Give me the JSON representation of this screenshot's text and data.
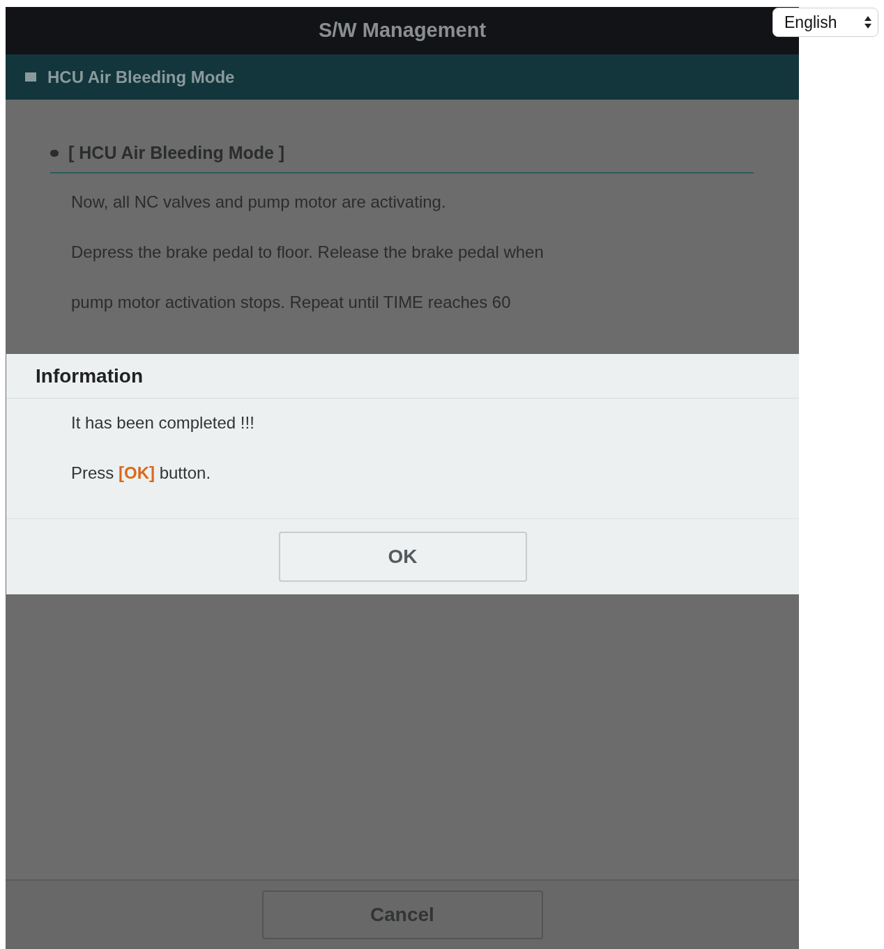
{
  "window": {
    "title": "S/W Management"
  },
  "section": {
    "title": "HCU Air Bleeding Mode"
  },
  "content": {
    "heading": "[ HCU Air Bleeding Mode ]",
    "paragraphs": [
      "Now, all NC valves and pump motor are activating.",
      "Depress the brake pedal to floor. Release the brake pedal when",
      "pump motor activation stops. Repeat until TIME reaches 60"
    ]
  },
  "dialog": {
    "title": "Information",
    "lines": [
      "It has been completed !!!",
      "Press **[OK]** button."
    ],
    "button": "OK"
  },
  "footer": {
    "button": "Cancel"
  },
  "language_select": {
    "value": "English"
  }
}
